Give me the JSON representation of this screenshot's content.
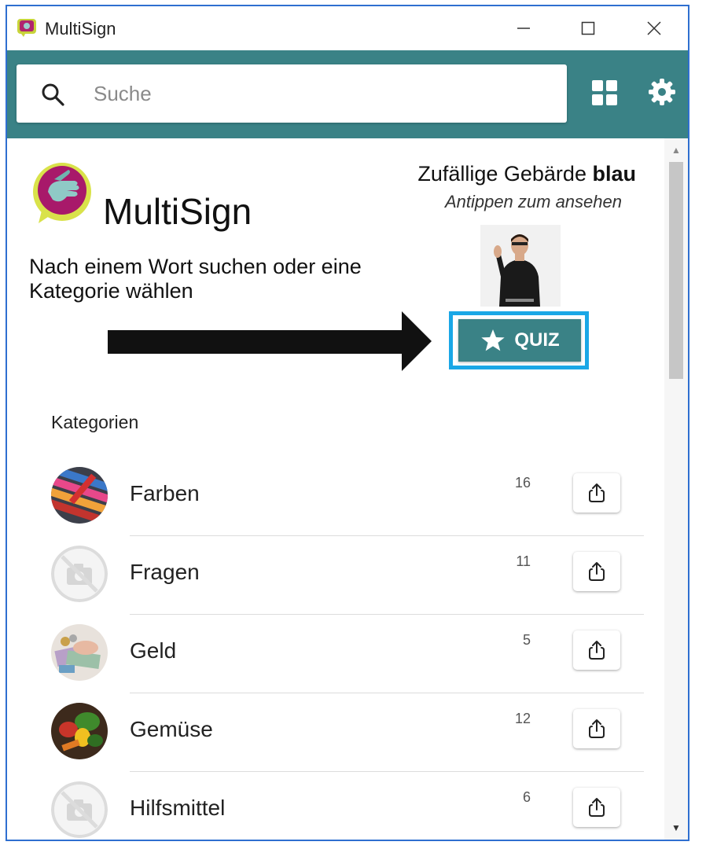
{
  "window": {
    "title": "MultiSign"
  },
  "search": {
    "placeholder": "Suche",
    "value": ""
  },
  "header": {
    "brand": "MultiSign",
    "intro": "Nach einem Wort suchen oder eine Kategorie wählen"
  },
  "random_sign": {
    "label": "Zufällige Gebärde",
    "word": "blau",
    "hint": "Antippen zum ansehen"
  },
  "quiz": {
    "label": "QUIZ"
  },
  "categories": {
    "heading": "Kategorien",
    "items": [
      {
        "name": "Farben",
        "count": "16",
        "image": "colors-image"
      },
      {
        "name": "Fragen",
        "count": "11",
        "image": "no-image-icon"
      },
      {
        "name": "Geld",
        "count": "5",
        "image": "money-image"
      },
      {
        "name": "Gemüse",
        "count": "12",
        "image": "vegetables-image"
      },
      {
        "name": "Hilfsmittel",
        "count": "6",
        "image": "no-image-icon"
      }
    ]
  },
  "colors": {
    "accent": "#3a8286",
    "highlight": "#1aa7e6",
    "window_border": "#2f6fd0"
  }
}
